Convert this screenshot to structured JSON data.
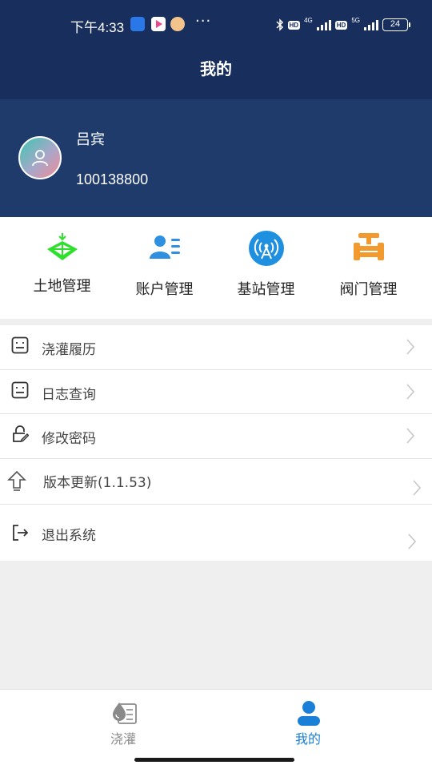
{
  "status_bar": {
    "time": "下午4:33",
    "more": "···",
    "network_1": "4G",
    "network_2": "5G",
    "hd": "HD",
    "battery": "24"
  },
  "nav": {
    "title": "我的"
  },
  "profile": {
    "name": "吕宾",
    "id": "100138800"
  },
  "quick_actions": [
    {
      "label": "土地管理",
      "icon": "land-icon",
      "color": "#2ee02c"
    },
    {
      "label": "账户管理",
      "icon": "account-icon",
      "color": "#2f8fe0"
    },
    {
      "label": "基站管理",
      "icon": "base-station-icon",
      "color": "#1f8fe0"
    },
    {
      "label": "阀门管理",
      "icon": "valve-icon",
      "color": "#f39a2e"
    }
  ],
  "menu": [
    {
      "label": "浇灌履历",
      "icon": "list-icon"
    },
    {
      "label": "日志查询",
      "icon": "list-icon"
    },
    {
      "label": "修改密码",
      "icon": "lock-edit-icon"
    },
    {
      "label": "版本更新(1.1.53)",
      "icon": "upload-arrow-icon"
    },
    {
      "label": "退出系统",
      "icon": "logout-icon"
    }
  ],
  "tabs": [
    {
      "label": "浇灌",
      "icon": "irrigation-icon",
      "active": false
    },
    {
      "label": "我的",
      "icon": "user-icon",
      "active": true
    }
  ],
  "colors": {
    "header": "#182f5e",
    "profile": "#1e3b6c",
    "active_tab": "#1a7fd6",
    "inactive_tab": "#8a8a8a"
  }
}
